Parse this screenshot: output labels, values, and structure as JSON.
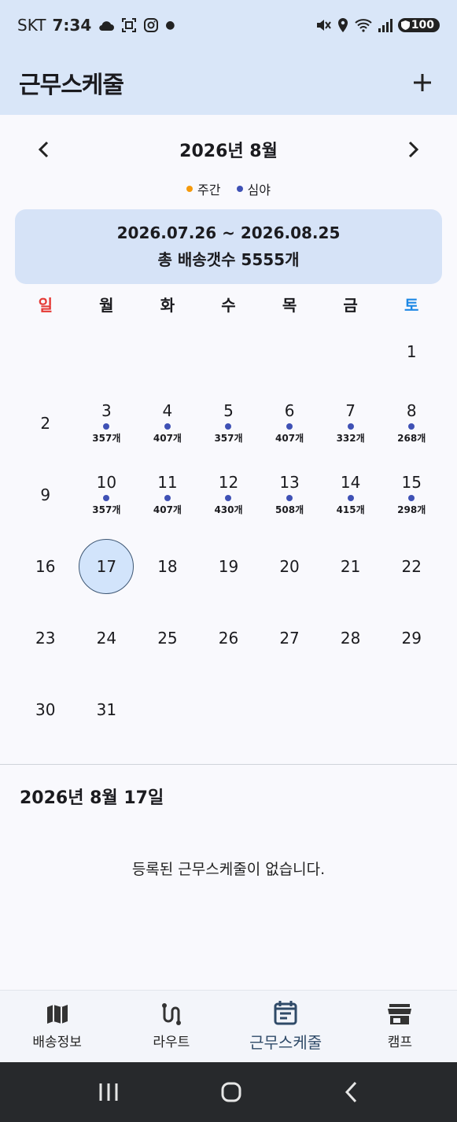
{
  "status_bar": {
    "carrier": "SKT",
    "time": "7:34",
    "battery": "100"
  },
  "app_bar": {
    "title": "근무스케줄"
  },
  "calendar": {
    "month_title": "2026년 8월",
    "legend": [
      {
        "label": "주간",
        "color": "#f59a0c"
      },
      {
        "label": "심야",
        "color": "#3f51b5"
      }
    ],
    "summary": {
      "range": "2026.07.26 ~ 2026.08.25",
      "total": "총 배송갯수 5555개"
    },
    "weekdays": [
      "일",
      "월",
      "화",
      "수",
      "목",
      "금",
      "토"
    ],
    "weekday_colors": {
      "sun": "#e53935",
      "sat": "#1e88e5"
    },
    "weeks": [
      [
        {
          "d": ""
        },
        {
          "d": ""
        },
        {
          "d": ""
        },
        {
          "d": ""
        },
        {
          "d": ""
        },
        {
          "d": ""
        },
        {
          "d": "1"
        }
      ],
      [
        {
          "d": "2"
        },
        {
          "d": "3",
          "c": "357개"
        },
        {
          "d": "4",
          "c": "407개"
        },
        {
          "d": "5",
          "c": "357개"
        },
        {
          "d": "6",
          "c": "407개"
        },
        {
          "d": "7",
          "c": "332개"
        },
        {
          "d": "8",
          "c": "268개"
        }
      ],
      [
        {
          "d": "9"
        },
        {
          "d": "10",
          "c": "357개"
        },
        {
          "d": "11",
          "c": "407개"
        },
        {
          "d": "12",
          "c": "430개"
        },
        {
          "d": "13",
          "c": "508개"
        },
        {
          "d": "14",
          "c": "415개"
        },
        {
          "d": "15",
          "c": "298개"
        }
      ],
      [
        {
          "d": "16"
        },
        {
          "d": "17",
          "selected": true
        },
        {
          "d": "18"
        },
        {
          "d": "19"
        },
        {
          "d": "20"
        },
        {
          "d": "21"
        },
        {
          "d": "22"
        }
      ],
      [
        {
          "d": "23"
        },
        {
          "d": "24"
        },
        {
          "d": "25"
        },
        {
          "d": "26"
        },
        {
          "d": "27"
        },
        {
          "d": "28"
        },
        {
          "d": "29"
        }
      ],
      [
        {
          "d": "30"
        },
        {
          "d": "31"
        },
        {
          "d": ""
        },
        {
          "d": ""
        },
        {
          "d": ""
        },
        {
          "d": ""
        },
        {
          "d": ""
        }
      ]
    ]
  },
  "detail": {
    "date_title": "2026년 8월 17일",
    "empty_message": "등록된 근무스케줄이 없습니다."
  },
  "bottom_nav": [
    {
      "label": "배송정보",
      "icon": "map-icon"
    },
    {
      "label": "라우트",
      "icon": "route-icon"
    },
    {
      "label": "근무스케줄",
      "icon": "calendar-icon",
      "active": true
    },
    {
      "label": "캠프",
      "icon": "store-icon"
    }
  ]
}
